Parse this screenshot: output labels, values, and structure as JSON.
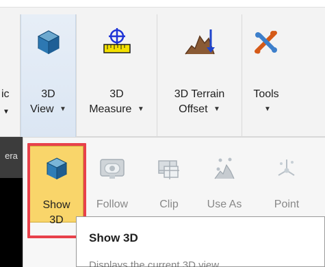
{
  "ribbon": {
    "partial": {
      "label": "ic"
    },
    "view_3d": {
      "label_line1": "3D",
      "label_line2": "View",
      "icon": "cube-icon"
    },
    "measure_3d": {
      "label_line1": "3D",
      "label_line2": "Measure",
      "icon": "measure-icon"
    },
    "terrain_offset": {
      "label_line1": "3D Terrain",
      "label_line2": "Offset",
      "icon": "terrain-offset-icon"
    },
    "tools": {
      "label": "Tools",
      "icon": "tools-icon"
    }
  },
  "left_panel": {
    "partial_text": "era"
  },
  "dropdown": {
    "items": [
      {
        "line1": "Show",
        "line2": "3D",
        "icon": "show-3d-icon"
      },
      {
        "line1": "Follow",
        "icon": "follow-icon"
      },
      {
        "line1": "Clip",
        "icon": "clip-icon"
      },
      {
        "line1": "Use As",
        "icon": "use-as-icon"
      },
      {
        "line1": "Point",
        "icon": "point-icon"
      }
    ]
  },
  "tooltip": {
    "title": "Show 3D",
    "partial_text": "Displays the current 3D view"
  },
  "colors": {
    "highlight": "#e8414b",
    "selected_fill": "#f9d56a",
    "dark_panel": "#3c3c3c"
  }
}
